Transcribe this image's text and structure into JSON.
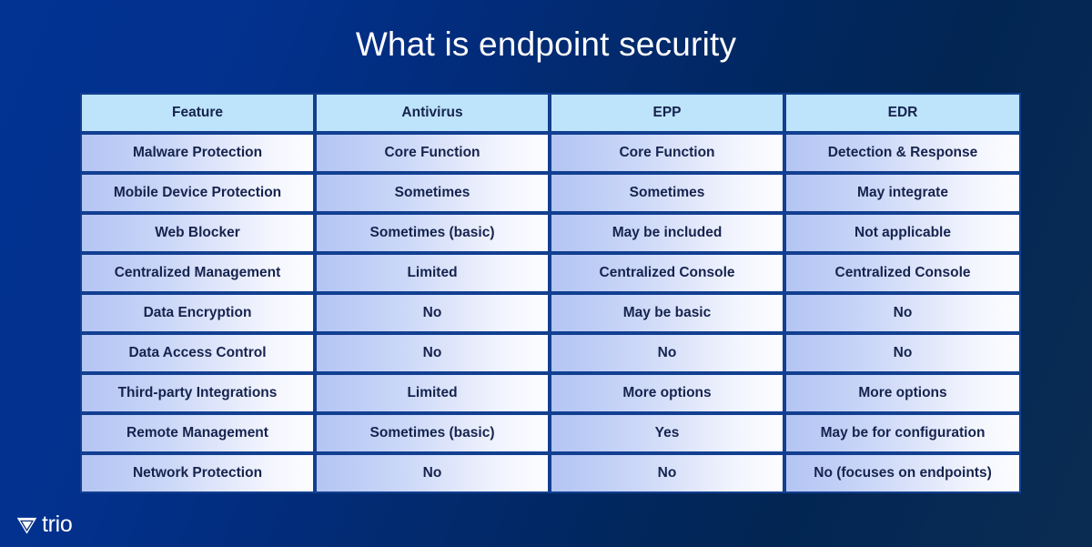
{
  "slide": {
    "title": "What is endpoint security"
  },
  "table": {
    "headers": [
      "Feature",
      "Antivirus",
      "EPP",
      "EDR"
    ],
    "rows": [
      [
        "Malware Protection",
        "Core Function",
        "Core Function",
        "Detection & Response"
      ],
      [
        "Mobile Device Protection",
        "Sometimes",
        "Sometimes",
        "May integrate"
      ],
      [
        "Web Blocker",
        "Sometimes (basic)",
        "May be included",
        "Not applicable"
      ],
      [
        "Centralized Management",
        "Limited",
        "Centralized Console",
        "Centralized Console"
      ],
      [
        "Data Encryption",
        "No",
        "May be basic",
        "No"
      ],
      [
        "Data Access Control",
        "No",
        "No",
        "No"
      ],
      [
        "Third-party Integrations",
        "Limited",
        "More options",
        "More options"
      ],
      [
        "Remote Management",
        "Sometimes (basic)",
        "Yes",
        "May be for configuration"
      ],
      [
        "Network Protection",
        "No",
        "No",
        "No (focuses on endpoints)"
      ]
    ]
  },
  "logo": {
    "name": "trio",
    "mark": "trio-triangle-icon"
  },
  "colors": {
    "background_start": "#023292",
    "background_end": "#0b2c52",
    "header_cell": "#bde4fb",
    "cell_gradient_start": "#b4c5f3",
    "cell_gradient_end": "#fdfdff",
    "cell_border": "#123f90",
    "text": "#16234e",
    "title_text": "#ffffff"
  }
}
